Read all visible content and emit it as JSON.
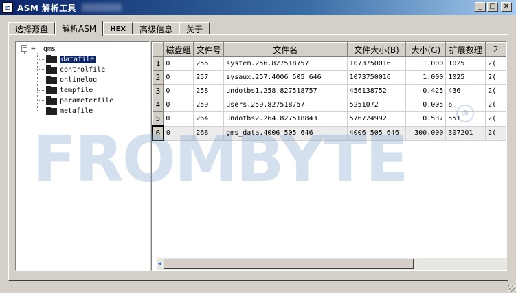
{
  "window": {
    "title": "ASM 解析工具",
    "buttons": {
      "minimize": "_",
      "maximize": "□",
      "close": "✕"
    }
  },
  "tabs": [
    {
      "label": "选择源盘"
    },
    {
      "label": "解析ASM"
    },
    {
      "label": "HEX"
    },
    {
      "label": "高级信息"
    },
    {
      "label": "关于"
    }
  ],
  "active_tab": 1,
  "tree": {
    "root": {
      "label": "gms",
      "toggle": "−"
    },
    "items": [
      {
        "label": "datafile"
      },
      {
        "label": "controlfile"
      },
      {
        "label": "onlinelog"
      },
      {
        "label": "tempfile"
      },
      {
        "label": "parameterfile"
      },
      {
        "label": "metafile"
      }
    ],
    "selected_index": 0
  },
  "grid": {
    "columns": [
      "磁盘组",
      "文件号",
      "文件名",
      "文件大小(B)",
      "大小(G)",
      "扩展数理",
      "2"
    ],
    "rows": [
      {
        "num": "1",
        "cells": [
          "0",
          "256",
          "system.256.827518757",
          "1073750016",
          "1.000",
          "1025",
          "2("
        ]
      },
      {
        "num": "2",
        "cells": [
          "0",
          "257",
          "sysaux.257.4006 505 646",
          "1073750016",
          "1.000",
          "1025",
          "2("
        ]
      },
      {
        "num": "3",
        "cells": [
          "0",
          "258",
          "undotbs1.258.827518757",
          "456138752",
          "0.425",
          "436",
          "2("
        ]
      },
      {
        "num": "4",
        "cells": [
          "0",
          "259",
          "users.259.827518757",
          "5251072",
          "0.005",
          "6",
          "2("
        ]
      },
      {
        "num": "5",
        "cells": [
          "0",
          "264",
          "undotbs2.264.827518843",
          "576724992",
          "0.537",
          "551",
          "2("
        ]
      },
      {
        "num": "6",
        "cells": [
          "0",
          "268",
          "gms_data.4006 505 646",
          "4006 505 646",
          "300.000",
          "307201",
          "2("
        ]
      }
    ],
    "current_row": 5
  },
  "watermark": {
    "text": "FROMBYTE",
    "reg": "®"
  },
  "colors": {
    "titlebar": "#0a246a",
    "selection": "#0a246a",
    "face": "#d4d0c8"
  }
}
